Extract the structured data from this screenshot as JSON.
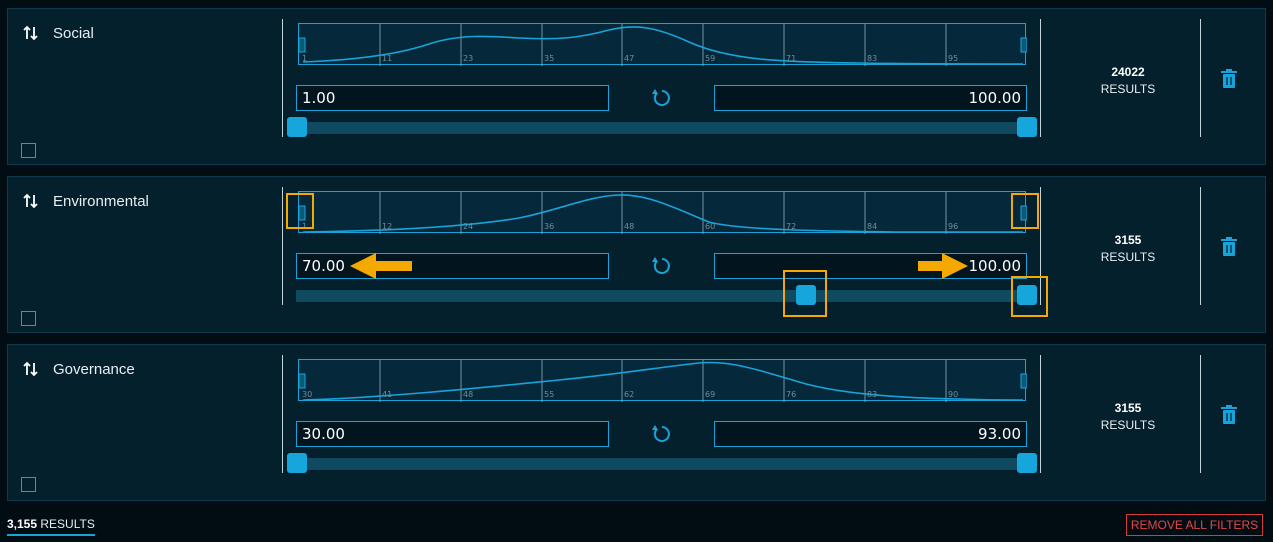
{
  "filters": [
    {
      "title": "Social",
      "ticks": [
        "1",
        "11",
        "23",
        "35",
        "47",
        "59",
        "71",
        "83",
        "95"
      ],
      "min_value": "1.00",
      "max_value": "100.00",
      "range": {
        "min": 1,
        "max": 100,
        "low": 1,
        "high": 100
      },
      "count": "24022",
      "count_label": "RESULTS"
    },
    {
      "title": "Environmental",
      "ticks": [
        "1",
        "12",
        "24",
        "36",
        "48",
        "60",
        "72",
        "84",
        "96"
      ],
      "min_value": "70.00",
      "max_value": "100.00",
      "range": {
        "min": 1,
        "max": 100,
        "low": 70,
        "high": 100
      },
      "count": "3155",
      "count_label": "RESULTS"
    },
    {
      "title": "Governance",
      "ticks": [
        "30",
        "41",
        "48",
        "55",
        "62",
        "69",
        "76",
        "83",
        "90"
      ],
      "min_value": "30.00",
      "max_value": "93.00",
      "range": {
        "min": 30,
        "max": 93,
        "low": 30,
        "high": 93
      },
      "count": "3155",
      "count_label": "RESULTS"
    }
  ],
  "footer": {
    "results_count": "3,155",
    "results_label": "RESULTS",
    "remove_all_label": "REMOVE ALL FILTERS"
  },
  "colors": {
    "accent": "#1aa3d9",
    "handle": "#17a6db",
    "callout": "#f5a800",
    "danger": "#d83a3a"
  },
  "icons": [
    "sort-arrows-icon",
    "reset-icon",
    "trash-icon",
    "min-handle-icon",
    "max-handle-icon"
  ]
}
